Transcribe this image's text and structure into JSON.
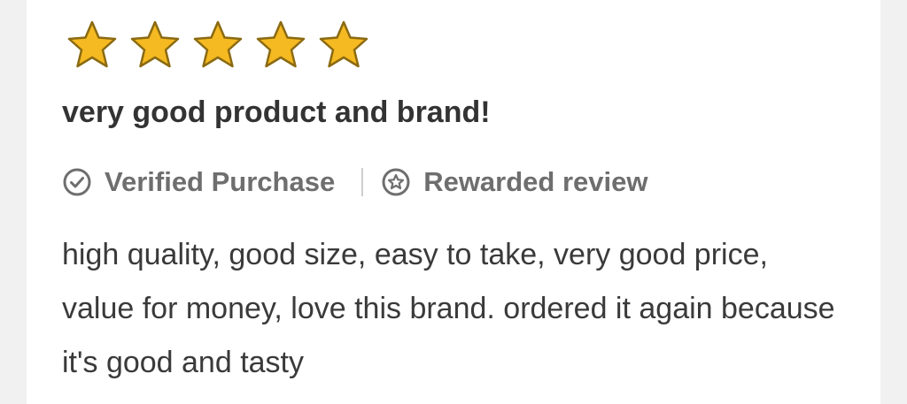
{
  "review": {
    "rating": 5,
    "rating_max": 5,
    "title": "very good product and brand!",
    "verified_label": "Verified Purchase",
    "rewarded_label": "Rewarded review",
    "text": "high quality, good size, easy to take, very good price, value for money, love this brand. ordered it again because it's good and tasty"
  },
  "icons": {
    "star": "star-icon",
    "verified": "check-circle-icon",
    "rewarded": "star-badge-icon"
  },
  "colors": {
    "star_fill": "#F5B921",
    "star_stroke": "#8A6A12",
    "title": "#333333",
    "meta": "#6E6E6E",
    "body": "#3A3A3A",
    "card": "#FFFFFF",
    "background": "#F1F1F1"
  }
}
